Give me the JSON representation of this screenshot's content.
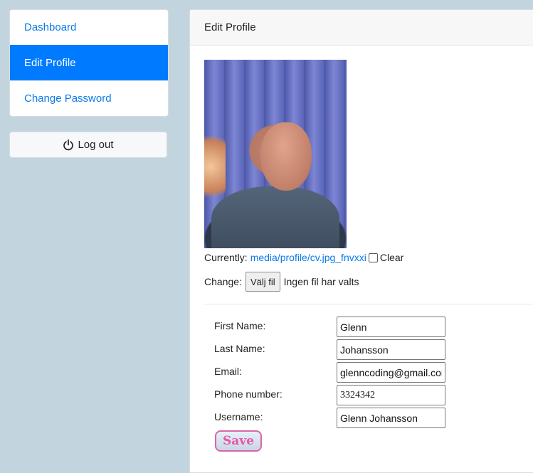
{
  "sidebar": {
    "items": [
      {
        "label": "Dashboard"
      },
      {
        "label": "Edit Profile"
      },
      {
        "label": "Change Password"
      }
    ],
    "logout_label": "Log out"
  },
  "card": {
    "title": "Edit Profile"
  },
  "profile_image": {
    "currently_label": "Currently:",
    "current_path": "media/profile/cv.jpg_fnvxxi",
    "clear_label": "Clear",
    "change_label": "Change:",
    "file_button": "Välj fil",
    "file_status": "Ingen fil har valts"
  },
  "form": {
    "first_name_label": "First Name:",
    "first_name_value": "Glenn",
    "last_name_label": "Last Name:",
    "last_name_value": "Johansson",
    "email_label": "Email:",
    "email_value": "glenncoding@gmail.com",
    "phone_label": "Phone number:",
    "phone_value": "3324342",
    "username_label": "Username:",
    "username_value": "Glenn Johansson",
    "save_label": "Save"
  },
  "colors": {
    "background": "#c2d5de",
    "active_nav": "#007bff",
    "link": "#0b7ae8",
    "save_text": "#e35aa6"
  },
  "icons": {
    "logout": "power-icon"
  }
}
